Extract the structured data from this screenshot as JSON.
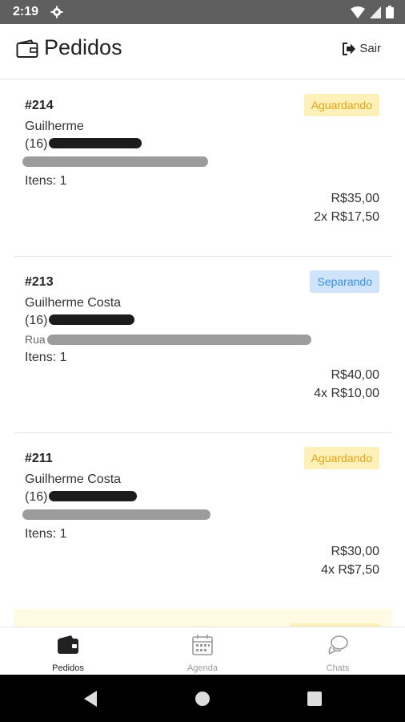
{
  "status_bar": {
    "time": "2:19",
    "icons": [
      "settings-icon",
      "wifi-icon",
      "signal-icon",
      "battery-icon"
    ]
  },
  "app_bar": {
    "title": "Pedidos",
    "logout_label": "Sair",
    "icon": "wallet-icon"
  },
  "orders": [
    {
      "number": "#214",
      "customer": "Guilherme",
      "phone_prefix": "(16)",
      "address_prefix": "",
      "items": "Itens: 1",
      "total": "R$35,00",
      "unit_line": "2x R$17,50",
      "status": "Aguardando",
      "status_color": "#e8a317"
    },
    {
      "number": "#213",
      "customer": "Guilherme Costa",
      "phone_prefix": "(16)",
      "address_prefix": "Rua",
      "items": "Itens: 1",
      "total": "R$40,00",
      "unit_line": "4x R$10,00",
      "status": "Separando",
      "status_color": "#3a8ee6"
    },
    {
      "number": "#211",
      "customer": "Guilherme Costa",
      "phone_prefix": "(16)",
      "address_prefix": "",
      "items": "Itens: 1",
      "total": "R$30,00",
      "unit_line": "4x R$7,50",
      "status": "Aguardando",
      "status_color": "#e8a317"
    }
  ],
  "tab_bar": {
    "tabs": [
      {
        "label": "Pedidos",
        "icon": "wallet-icon",
        "active": true
      },
      {
        "label": "Agenda",
        "icon": "calendar-icon",
        "active": false
      },
      {
        "label": "Chats",
        "icon": "chat-icon",
        "active": false
      }
    ]
  },
  "nav_bar": {
    "buttons": [
      "back-icon",
      "home-icon",
      "recents-icon"
    ]
  }
}
